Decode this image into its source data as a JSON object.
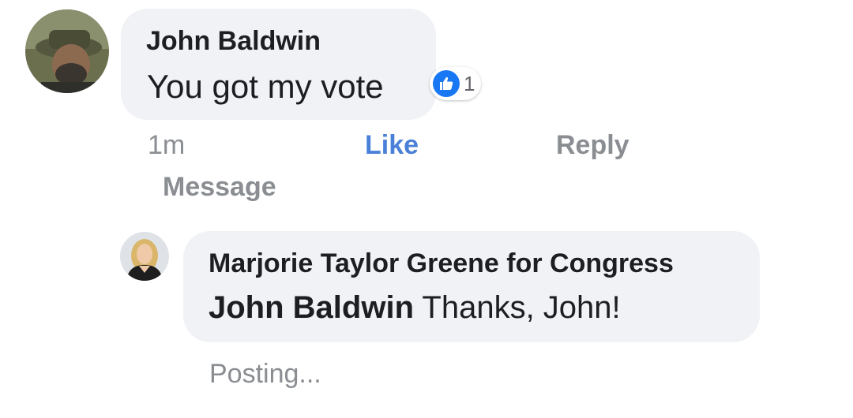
{
  "comment": {
    "author": "John Baldwin",
    "text": "You got my vote",
    "reaction": {
      "icon": "thumbs-up-icon",
      "count": "1",
      "color": "#1877f2"
    },
    "meta": {
      "time": "1m",
      "like_label": "Like",
      "reply_label": "Reply",
      "message_label": "Message"
    }
  },
  "reply": {
    "author": "Marjorie Taylor Greene for Congress",
    "mention": "John Baldwin",
    "text": " Thanks, John!",
    "status": "Posting..."
  },
  "colors": {
    "bubble": "#f0f2f5",
    "text": "#1c1e21",
    "muted": "#8a8d91",
    "link": "#4a80d8"
  }
}
